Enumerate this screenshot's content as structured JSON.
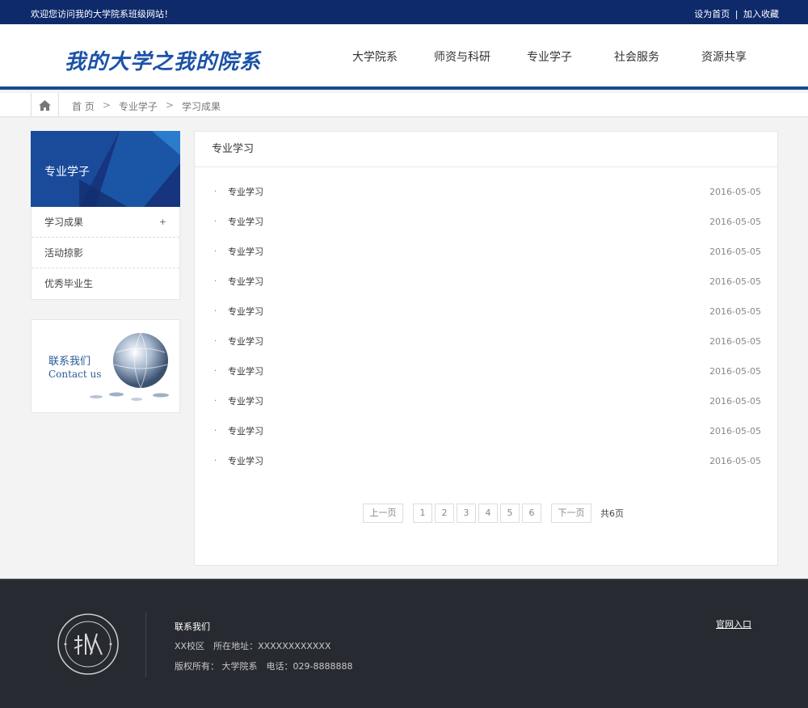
{
  "topbar": {
    "welcome": "欢迎您访问我的大学院系班级网站！",
    "set_home": "设为首页",
    "divider": "|",
    "favorite": "加入收藏"
  },
  "header": {
    "logo": "我的大学之我的院系",
    "nav": [
      "大学院系",
      "师资与科研",
      "专业学子",
      "社会服务",
      "资源共享"
    ]
  },
  "breadcrumb": {
    "home": "首 页",
    "sep": ">",
    "level1": "专业学子",
    "level2": "学习成果"
  },
  "sidebar": {
    "title": "专业学子",
    "items": [
      {
        "label": "学习成果",
        "marker": "+"
      },
      {
        "label": "活动掠影"
      },
      {
        "label": "优秀毕业生"
      }
    ],
    "contact_cn": "联系我们",
    "contact_en": "Contact us"
  },
  "main": {
    "title": "专业学习",
    "bullet": "·",
    "items": [
      {
        "title": "专业学习",
        "date": "2016-05-05"
      },
      {
        "title": "专业学习",
        "date": "2016-05-05"
      },
      {
        "title": "专业学习",
        "date": "2016-05-05"
      },
      {
        "title": "专业学习",
        "date": "2016-05-05"
      },
      {
        "title": "专业学习",
        "date": "2016-05-05"
      },
      {
        "title": "专业学习",
        "date": "2016-05-05"
      },
      {
        "title": "专业学习",
        "date": "2016-05-05"
      },
      {
        "title": "专业学习",
        "date": "2016-05-05"
      },
      {
        "title": "专业学习",
        "date": "2016-05-05"
      },
      {
        "title": "专业学习",
        "date": "2016-05-05"
      }
    ],
    "pager": {
      "prev": "上一页",
      "pages": [
        "1",
        "2",
        "3",
        "4",
        "5",
        "6"
      ],
      "next": "下一页",
      "total": "共6页"
    }
  },
  "footer": {
    "heading": "联系我们",
    "line1": "XX校区　所在地址：XXXXXXXXXXXX",
    "line2": "版权所有： 大学院系　电话：029-8888888",
    "entry": "官网入口"
  },
  "colors": {
    "topbar": "#0f2a6b",
    "accent": "#174b8f",
    "footer": "#272a30"
  }
}
